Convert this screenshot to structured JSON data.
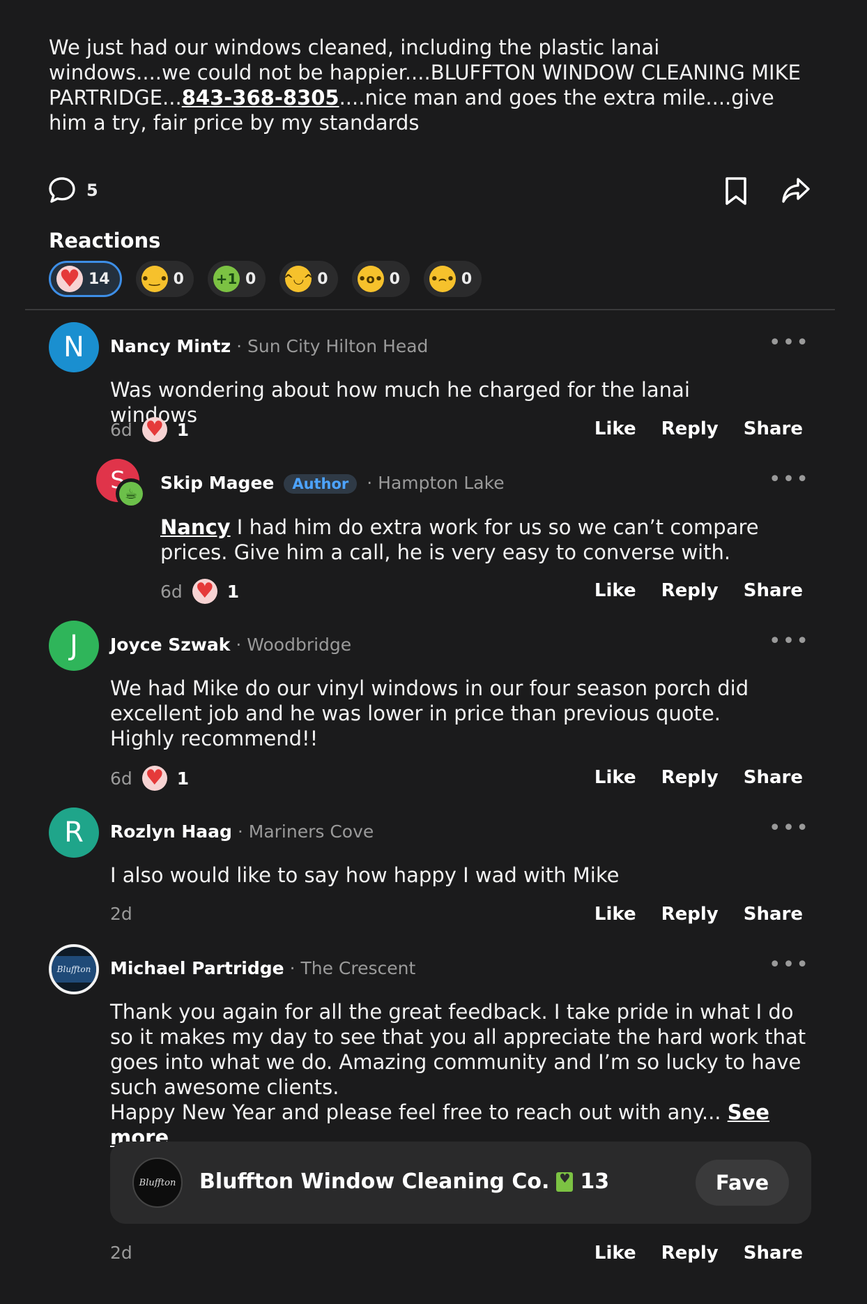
{
  "post": {
    "text_part1": "We just had our windows cleaned, including the plastic lanai windows....we could not be happier....BLUFFTON WINDOW CLEANING MIKE PARTRIDGE...",
    "phone": "843-368-8305",
    "text_part2": "....nice man and goes the extra mile....give him a try, fair price by my standards",
    "comment_count": "5"
  },
  "reactions": {
    "title": "Reactions",
    "items": [
      {
        "icon": "heart-icon",
        "count": "14"
      },
      {
        "icon": "smile-icon",
        "count": "0"
      },
      {
        "icon": "plus-one-icon",
        "count": "0"
      },
      {
        "icon": "grin-icon",
        "count": "0"
      },
      {
        "icon": "wow-icon",
        "count": "0"
      },
      {
        "icon": "sad-icon",
        "count": "0"
      }
    ]
  },
  "actions": {
    "like": "Like",
    "reply": "Reply",
    "share": "Share"
  },
  "comments": [
    {
      "initial": "N",
      "avatar_color": "#1a8fd0",
      "name": "Nancy Mintz",
      "location": "· Sun City Hilton Head",
      "text": "Was wondering about how much he charged for the lanai windows",
      "time": "6d",
      "likes": "1"
    },
    {
      "initial": "S",
      "avatar_color": "#e0344a",
      "name": "Skip Magee",
      "badge": "Author",
      "location": "· Hampton Lake",
      "mention": "Nancy",
      "text": " I had him do extra work for us so we can’t compare prices. Give him a call, he is very easy to converse with.",
      "time": "6d",
      "likes": "1"
    },
    {
      "initial": "J",
      "avatar_color": "#2fb55a",
      "name": "Joyce Szwak",
      "location": "· Woodbridge",
      "text": "We had Mike do our vinyl windows in our four season porch did excellent job and he was lower in price than previous quote. Highly recommend!!",
      "time": "6d",
      "likes": "1"
    },
    {
      "initial": "R",
      "avatar_color": "#1fa58a",
      "name": "Rozlyn Haag",
      "location": "· Mariners Cove",
      "text": "I also would like to say how happy I wad with Mike",
      "time": "2d"
    },
    {
      "name": "Michael Partridge",
      "location": "· The Crescent",
      "text": "Thank you again for all the great feedback.  I take pride in what I do so it makes my day to see that you all appreciate the hard work that goes into what we do. Amazing community and I’m so lucky to have such awesome clients.",
      "text2": "Happy New Year and please feel free to reach out with any...",
      "see_more": "See more",
      "time": "2d"
    }
  ],
  "business": {
    "name": "Bluffton Window Cleaning Co.",
    "fave_count": "13",
    "fave_label": "Fave",
    "logo_text": "Bluffton"
  }
}
